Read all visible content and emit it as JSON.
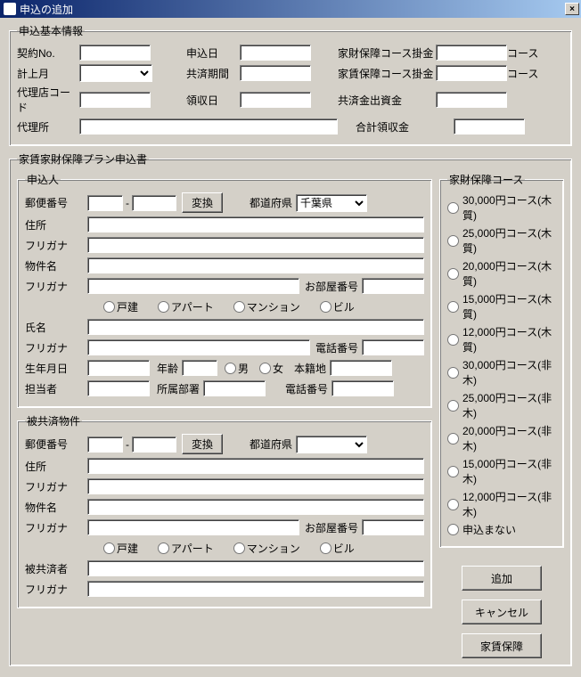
{
  "title": "申込の追加",
  "close_x": "×",
  "basic": {
    "legend": "申込基本情報",
    "labels": {
      "keiyaku_no": "契約No.",
      "moushikomi_date": "申込日",
      "kazai_kakekin": "家財保障コース掛金",
      "course_suffix": "コース",
      "keijou_tsuki": "計上月",
      "kyousai_kikan": "共済期間",
      "yachin_kakekin": "家賃保障コース掛金",
      "dairiten_code": "代理店コード",
      "ryoushuu_date": "領収日",
      "shusshikin": "共済金出資金",
      "dairiten": "代理所",
      "goukei_ryoushuu": "合計領収金"
    }
  },
  "form": {
    "legend": "家賃家財保障プラン申込書",
    "applicant": {
      "legend": "申込人",
      "labels": {
        "yubin": "郵便番号",
        "henkan": "変換",
        "todofuken": "都道府県",
        "chiba": "千葉県",
        "jusho": "住所",
        "furigana": "フリガナ",
        "bukken_mei": "物件名",
        "oheya_bangou": "お部屋番号",
        "kodate": "戸建",
        "apart": "アパート",
        "mansion": "マンション",
        "building": "ビル",
        "shimei": "氏名",
        "denwa": "電話番号",
        "seinen": "生年月日",
        "nenrei": "年齢",
        "otoko": "男",
        "onna": "女",
        "honseki": "本籍地",
        "tantousha": "担当者",
        "shozoku": "所属部署"
      }
    },
    "property": {
      "legend": "被共済物件",
      "labels": {
        "hikyousaisha": "被共済者"
      }
    },
    "course": {
      "legend": "家財保障コース",
      "options": [
        "30,000円コース(木質)",
        "25,000円コース(木質)",
        "20,000円コース(木質)",
        "15,000円コース(木質)",
        "12,000円コース(木質)",
        "30,000円コース(非木)",
        "25,000円コース(非木)",
        "20,000円コース(非木)",
        "15,000円コース(非木)",
        "12,000円コース(非木)",
        "申込まない"
      ]
    },
    "buttons": {
      "add": "追加",
      "cancel": "キャンセル",
      "yachin_hoshou": "家賃保障"
    }
  }
}
